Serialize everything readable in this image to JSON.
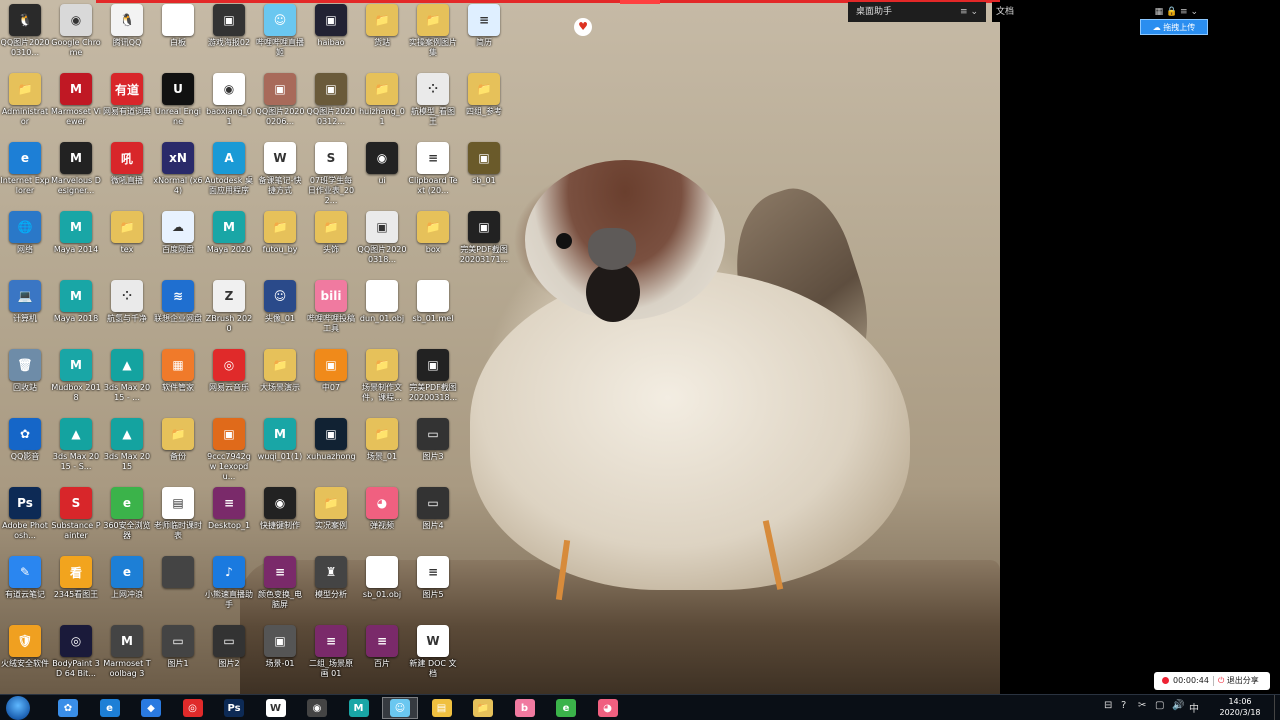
{
  "desktop": {
    "columns": [
      [
        {
          "label": "QQ图片20200310...",
          "icon": "image-icon",
          "color": "#2a2a2a",
          "glyph": "🐧"
        },
        {
          "label": "Administrator",
          "icon": "folder-icon",
          "color": "#e6c15a",
          "glyph": "📁"
        },
        {
          "label": "Internet Explorer",
          "icon": "ie-icon",
          "color": "#1d7fd6",
          "glyph": "e"
        },
        {
          "label": "网络",
          "icon": "network-icon",
          "color": "#2a78c8",
          "glyph": "🌐"
        },
        {
          "label": "计算机",
          "icon": "computer-icon",
          "color": "#3a76c4",
          "glyph": "💻"
        },
        {
          "label": "回收站",
          "icon": "recycle-bin-icon",
          "color": "#6e8ca8",
          "glyph": "🗑"
        },
        {
          "label": "QQ影音",
          "icon": "qqplayer-icon",
          "color": "#1566c8",
          "glyph": "✿"
        },
        {
          "label": "Adobe Photosh...",
          "icon": "photoshop-icon",
          "color": "#0d2a55",
          "glyph": "Ps"
        },
        {
          "label": "有道云笔记",
          "icon": "youdao-note-icon",
          "color": "#2a86f0",
          "glyph": "✎"
        },
        {
          "label": "火绒安全软件",
          "icon": "huorong-icon",
          "color": "#f0a020",
          "glyph": "🛡"
        }
      ],
      [
        {
          "label": "Google Chrome",
          "icon": "chrome-icon",
          "color": "#d9d9d9",
          "glyph": "◉"
        },
        {
          "label": "Marmoset Viewer",
          "icon": "marmoset-icon",
          "color": "#c01824",
          "glyph": "M"
        },
        {
          "label": "Marvelous Designer...",
          "icon": "marvelous-icon",
          "color": "#222",
          "glyph": "M"
        },
        {
          "label": "Maya 2014",
          "icon": "maya-icon",
          "color": "#19a6a6",
          "glyph": "M"
        },
        {
          "label": "Maya 2018",
          "icon": "maya-icon",
          "color": "#19a6a6",
          "glyph": "M"
        },
        {
          "label": "Mudbox 2018",
          "icon": "mudbox-icon",
          "color": "#19a6a6",
          "glyph": "M"
        },
        {
          "label": "3ds Max 2015 - S...",
          "icon": "3dsmax-icon",
          "color": "#14a3a0",
          "glyph": "▲"
        },
        {
          "label": "Substance Painter",
          "icon": "substance-icon",
          "color": "#d8262a",
          "glyph": "S"
        },
        {
          "label": "2345看图王",
          "icon": "viewer-2345-icon",
          "color": "#f2a41e",
          "glyph": "看"
        },
        {
          "label": "BodyPaint 3D 64 Bit...",
          "icon": "bodypaint-icon",
          "color": "#1a1a3a",
          "glyph": "◎"
        }
      ],
      [
        {
          "label": "腾讯QQ",
          "icon": "qq-icon",
          "color": "#f3f3f3",
          "glyph": "🐧"
        },
        {
          "label": "网易有道词典",
          "icon": "youdao-dict-icon",
          "color": "#d8262a",
          "glyph": "有道"
        },
        {
          "label": "微吼直播",
          "icon": "weihou-icon",
          "color": "#d8262a",
          "glyph": "吼"
        },
        {
          "label": "tex",
          "icon": "folder-icon",
          "color": "#e6c15a",
          "glyph": "📁"
        },
        {
          "label": "航氢与千净",
          "icon": "app-icon",
          "color": "#eaeaea",
          "glyph": "⁘"
        },
        {
          "label": "3ds Max 2015 - ...",
          "icon": "3dsmax-icon",
          "color": "#14a3a0",
          "glyph": "▲"
        },
        {
          "label": "3ds Max 2015",
          "icon": "3dsmax-icon",
          "color": "#14a3a0",
          "glyph": "▲"
        },
        {
          "label": "360安全浏览器",
          "icon": "360-browser-icon",
          "color": "#3bb34a",
          "glyph": "e"
        },
        {
          "label": "上网冲浪",
          "icon": "ie-icon",
          "color": "#1d7fd6",
          "glyph": "e"
        },
        {
          "label": "Marmoset Toolbag 3",
          "icon": "marmoset-icon",
          "color": "#444",
          "glyph": "M"
        }
      ],
      [
        {
          "label": "白板",
          "icon": "blank-file-icon",
          "color": "#ffffff",
          "glyph": ""
        },
        {
          "label": "Unreal Engine",
          "icon": "unreal-icon",
          "color": "#111",
          "glyph": "U"
        },
        {
          "label": "xNormal (x64)",
          "icon": "xnormal-icon",
          "color": "#2a2a6a",
          "glyph": "xN"
        },
        {
          "label": "百度网盘",
          "icon": "baidu-pan-icon",
          "color": "#e8f2ff",
          "glyph": "☁"
        },
        {
          "label": "联想企业网盘",
          "icon": "lenovo-pan-icon",
          "color": "#1f6fd0",
          "glyph": "≋"
        },
        {
          "label": "软件管家",
          "icon": "software-manager-icon",
          "color": "#f07a2a",
          "glyph": "▦"
        },
        {
          "label": "备份",
          "icon": "folder-icon",
          "color": "#e6c15a",
          "glyph": "📁"
        },
        {
          "label": "老师临时课时表",
          "icon": "excel-file-icon",
          "color": "#ffffff",
          "glyph": "▤"
        },
        {
          "label": "",
          "icon": "blank-icon",
          "color": "#444",
          "glyph": ""
        },
        {
          "label": "图片1",
          "icon": "image-file-icon",
          "color": "#444",
          "glyph": "▭"
        }
      ],
      [
        {
          "label": "游戏海报02",
          "icon": "image-icon",
          "color": "#333",
          "glyph": "▣"
        },
        {
          "label": "baoxiang_01",
          "icon": "file-icon",
          "color": "#ffffff",
          "glyph": "◉"
        },
        {
          "label": "Autodesk 桌面应用程序",
          "icon": "autodesk-icon",
          "color": "#1a9ad6",
          "glyph": "A"
        },
        {
          "label": "Maya 2020",
          "icon": "maya-icon",
          "color": "#19a6a6",
          "glyph": "M"
        },
        {
          "label": "ZBrush 2020",
          "icon": "zbrush-icon",
          "color": "#f0f0f0",
          "glyph": "Z"
        },
        {
          "label": "网易云音乐",
          "icon": "netease-music-icon",
          "color": "#e02a2a",
          "glyph": "◎"
        },
        {
          "label": "9ccc7942gw 1exopdu...",
          "icon": "image-icon",
          "color": "#e06a1a",
          "glyph": "▣"
        },
        {
          "label": "Desktop_1",
          "icon": "winrar-icon",
          "color": "#7a2a6a",
          "glyph": "≡"
        },
        {
          "label": "小熊速直播助手",
          "icon": "music-icon",
          "color": "#1a7ae0",
          "glyph": "♪"
        },
        {
          "label": "图片2",
          "icon": "image-file-icon",
          "color": "#333",
          "glyph": "▭"
        }
      ],
      [
        {
          "label": "哔哩哔哩直播姬",
          "icon": "bilibili-live-icon",
          "color": "#6ac7f0",
          "glyph": "☺"
        },
        {
          "label": "QQ图片20200206...",
          "icon": "image-icon",
          "color": "#a86a5a",
          "glyph": "▣"
        },
        {
          "label": "备课笔记-快捷方式",
          "icon": "word-file-icon",
          "color": "#ffffff",
          "glyph": "W"
        },
        {
          "label": "futou_by",
          "icon": "folder-icon",
          "color": "#e6c15a",
          "glyph": "📁"
        },
        {
          "label": "头像_01",
          "icon": "image-icon",
          "color": "#2a4a8a",
          "glyph": "☺"
        },
        {
          "label": "大场景演示",
          "icon": "folder-icon",
          "color": "#e6c15a",
          "glyph": "📁"
        },
        {
          "label": "wuqi_01(1)",
          "icon": "maya-file-icon",
          "color": "#19a6a6",
          "glyph": "M"
        },
        {
          "label": "快捷键制作",
          "icon": "video-icon",
          "color": "#222",
          "glyph": "◉"
        },
        {
          "label": "颜色变换_电脑屏",
          "icon": "winrar-icon",
          "color": "#7a2a6a",
          "glyph": "≡"
        },
        {
          "label": "场景-01",
          "icon": "image-icon",
          "color": "#555",
          "glyph": "▣"
        }
      ],
      [
        {
          "label": "haibao",
          "icon": "image-icon",
          "color": "#223",
          "glyph": "▣"
        },
        {
          "label": "QQ图片20200312...",
          "icon": "image-icon",
          "color": "#6a5a3a",
          "glyph": "▣"
        },
        {
          "label": "07班学生每日作业表_202...",
          "icon": "excel-file-icon",
          "color": "#ffffff",
          "glyph": "S"
        },
        {
          "label": "头饰",
          "icon": "folder-icon",
          "color": "#e6c15a",
          "glyph": "📁"
        },
        {
          "label": "哔哩哔哩投稿工具",
          "icon": "bilibili-icon",
          "color": "#f07aa0",
          "glyph": "bili"
        },
        {
          "label": "中07",
          "icon": "image-icon",
          "color": "#f08a1a",
          "glyph": "▣"
        },
        {
          "label": "xuhuazhong",
          "icon": "image-icon",
          "color": "#123",
          "glyph": "▣"
        },
        {
          "label": "实况案例",
          "icon": "folder-icon",
          "color": "#e6c15a",
          "glyph": "📁"
        },
        {
          "label": "模型分析",
          "icon": "model-icon",
          "color": "#444",
          "glyph": "♜"
        },
        {
          "label": "二组_场景原画 01",
          "icon": "winrar-icon",
          "color": "#7a2a6a",
          "glyph": "≡"
        }
      ],
      [
        {
          "label": "货站",
          "icon": "folder-icon",
          "color": "#e6c15a",
          "glyph": "📁"
        },
        {
          "label": "huizhang_01",
          "icon": "folder-icon",
          "color": "#e6c15a",
          "glyph": "📁"
        },
        {
          "label": "ui",
          "icon": "image-icon",
          "color": "#222",
          "glyph": "◉"
        },
        {
          "label": "QQ图片20200318...",
          "icon": "image-icon",
          "color": "#eaeaea",
          "glyph": "▣"
        },
        {
          "label": "dun_01.obj",
          "icon": "blank-file-icon",
          "color": "#ffffff",
          "glyph": ""
        },
        {
          "label": "场景制作文件，课程...",
          "icon": "folder-icon",
          "color": "#e6c15a",
          "glyph": "📁"
        },
        {
          "label": "场景_01",
          "icon": "folder-icon",
          "color": "#e6c15a",
          "glyph": "📁"
        },
        {
          "label": "弹视频",
          "icon": "danmu-icon",
          "color": "#f06080",
          "glyph": "◕"
        },
        {
          "label": "sb_01.obj",
          "icon": "blank-file-icon",
          "color": "#ffffff",
          "glyph": ""
        },
        {
          "label": "百片",
          "icon": "winrar-icon",
          "color": "#7a2a6a",
          "glyph": "≡"
        }
      ],
      [
        {
          "label": "实操案例图片集",
          "icon": "folder-icon",
          "color": "#e6c15a",
          "glyph": "📁"
        },
        {
          "label": "航模型_看图王",
          "icon": "app-icon",
          "color": "#eaeaea",
          "glyph": "⁘"
        },
        {
          "label": "Clipboard Text (20...",
          "icon": "text-file-icon",
          "color": "#ffffff",
          "glyph": "≡"
        },
        {
          "label": "box",
          "icon": "folder-icon",
          "color": "#e6c15a",
          "glyph": "📁"
        },
        {
          "label": "sb_01.mel",
          "icon": "blank-file-icon",
          "color": "#ffffff",
          "glyph": ""
        },
        {
          "label": "完美PDF截图20200318...",
          "icon": "image-icon",
          "color": "#222",
          "glyph": "▣"
        },
        {
          "label": "图片3",
          "icon": "image-file-icon",
          "color": "#333",
          "glyph": "▭"
        },
        {
          "label": "图片4",
          "icon": "image-file-icon",
          "color": "#333",
          "glyph": "▭"
        },
        {
          "label": "图片5",
          "icon": "text-file-icon",
          "color": "#ffffff",
          "glyph": "≡"
        },
        {
          "label": "新建 DOC 文档",
          "icon": "word-file-icon",
          "color": "#ffffff",
          "glyph": "W"
        }
      ],
      [
        {
          "label": "简历",
          "icon": "document-icon",
          "color": "#dfefff",
          "glyph": "≡"
        },
        {
          "label": "四组_参考",
          "icon": "folder-icon",
          "color": "#e6c15a",
          "glyph": "📁"
        },
        {
          "label": "sb_01",
          "icon": "image-icon",
          "color": "#6a5a2a",
          "glyph": "▣"
        },
        {
          "label": "完美PDF截图20203171...",
          "icon": "image-icon",
          "color": "#222",
          "glyph": "▣"
        }
      ]
    ]
  },
  "fences": {
    "left_title": "桌面助手",
    "left_controls": "≡  ⌄",
    "right_title": "文档",
    "right_controls": "▦ 🔒 ≡ ⌄",
    "drag_upload": "拖拽上传"
  },
  "recording": {
    "time": "00:00:44",
    "exit_label": "退出分享"
  },
  "taskbar": {
    "apps": [
      {
        "name": "360-icon",
        "color": "#3a8ee8",
        "glyph": "✿",
        "active": false
      },
      {
        "name": "ie-icon",
        "color": "#1d7fd6",
        "glyph": "e",
        "active": false
      },
      {
        "name": "blue-app-icon",
        "color": "#2a7ae0",
        "glyph": "◆",
        "active": false
      },
      {
        "name": "netease-music-icon",
        "color": "#e02a2a",
        "glyph": "◎",
        "active": false
      },
      {
        "name": "photoshop-icon",
        "color": "#0d2a55",
        "glyph": "Ps",
        "active": false
      },
      {
        "name": "w-app-icon",
        "color": "#ffffff",
        "glyph": "W",
        "active": false
      },
      {
        "name": "obs-icon",
        "color": "#444",
        "glyph": "◉",
        "active": false
      },
      {
        "name": "maya-icon",
        "color": "#19a6a6",
        "glyph": "M",
        "active": false
      },
      {
        "name": "bilibili-live-icon",
        "color": "#6ac7f0",
        "glyph": "☺",
        "active": true
      },
      {
        "name": "notes-icon",
        "color": "#f0c040",
        "glyph": "▤",
        "active": false
      },
      {
        "name": "explorer-icon",
        "color": "#e6c15a",
        "glyph": "📁",
        "active": false
      },
      {
        "name": "bilibili-icon",
        "color": "#f07aa0",
        "glyph": "b",
        "active": false
      },
      {
        "name": "360-browser-icon",
        "color": "#3bb34a",
        "glyph": "e",
        "active": false
      },
      {
        "name": "danmu-icon",
        "color": "#f06080",
        "glyph": "◕",
        "active": false
      }
    ],
    "tray": [
      "⊟",
      "?",
      "✂",
      "▢",
      "🔊",
      "中"
    ],
    "time": "14:06",
    "date": "2020/3/18"
  }
}
